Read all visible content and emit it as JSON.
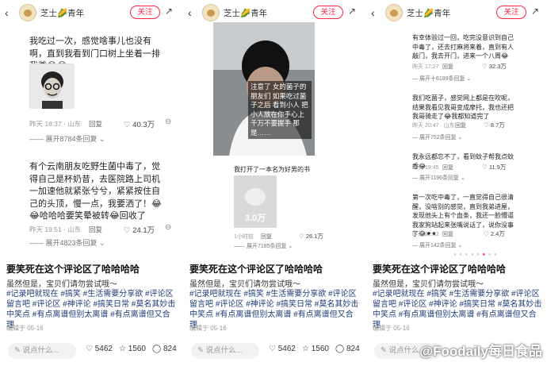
{
  "header": {
    "username": "芝士🌽青年",
    "follow_label": "关注",
    "back_glyph": "‹",
    "share_glyph": "↗"
  },
  "post": {
    "title": "要笑死在这个评论区了哈哈哈哈",
    "subtitle": "虽然但是，宝贝们请勿尝试哦～",
    "tags": "#记录吧就现在 #搞笑 #生活需要分享欲 #评论区留言吧 #评论区 #神评论 #搞笑日常 #莫名其妙击中笑点 #有点离谱但别太离谱 #有点离谱但又合理",
    "date": "编辑于 05-16"
  },
  "bottom_bar": {
    "comment_placeholder": "说点什么...",
    "likes": "5462",
    "stars": "1560",
    "comments": "824"
  },
  "panel1": {
    "c1_text": "我吃过一次，感觉啥事儿也没有啊，直到我看到门口树上坐着一排我爹😂😂",
    "c1_meta": "昨天 18:37 · 山东",
    "c1_reply": "回复",
    "c1_likes": "40.3万",
    "c1_expand": "展开8784条回复 ⌄",
    "c2_text": "有个云南朋友吃野生菌中毒了，觉得自己是杯奶昔，去医院路上司机一加速他就紧张兮兮，紧紧按住自己的头顶，慢一点，我要洒了！😂😂哈哈哈要笑晕被转😂回收了",
    "c2_meta": "昨天 19:51 · 山东",
    "c2_reply": "回复",
    "c2_likes": "24.1万",
    "c2_expand": "展开4823条回复 ⌄"
  },
  "panel2": {
    "video_caption": "注意了 女的菌子的朋友们 如果吃过菌子之后 看到小人 把小人放在你手心上 千万不要握手 那是……",
    "inner_text": "我打开了一本名为好男的书",
    "inner_count": "3.0万",
    "inner_meta": "1小时前",
    "inner_reply": "回复",
    "inner_likes": "26.1万",
    "inner_expand": "展开7185条回复 ⌄"
  },
  "panel3": {
    "c1_text": "有幸体验过一回，吃完没意识到自己中毒了，还去打麻将来着，直到有人敲门，我去开门，进来一个八周😂",
    "c1_meta": "昨天 17:27",
    "c1_reply": "回复",
    "c1_likes": "32.3万",
    "c1_expand": "展开十6189条回复 ⌄",
    "c2_text": "我们吃菌子，感觉网上都是在吹呢，结果我看见我哥变成摩托，我也还把我哥骑走了😂我都知道完了",
    "c2_meta": "昨天 20:47 · 山东",
    "c2_reply": "回复",
    "c2_likes": "8.7万",
    "c2_expand": "展开752条回复 ⌄",
    "c3_text": "我永远都忘不了，看到蚊子帮我点蚊香😂",
    "c3_meta": "昨天 19:45",
    "c3_reply": "回复",
    "c3_likes": "11.9万",
    "c3_expand": "展开1196条回复 ⌄",
    "c4_text": "第一次吃中毒了，一直觉得自己很清醒，没啥别的感觉，直到我弟进屋，发现他头上有个血条，我还一脸懵逼 我家狗站起来张嘴说话了，说你没事了😂⚫⚫",
    "c4_meta": "昨天 22:02",
    "c4_reply": "回复",
    "c4_likes": "2.4万",
    "c4_expand": "展开142条回复 ⌄"
  },
  "watermark": "@Foodaily每日食品"
}
